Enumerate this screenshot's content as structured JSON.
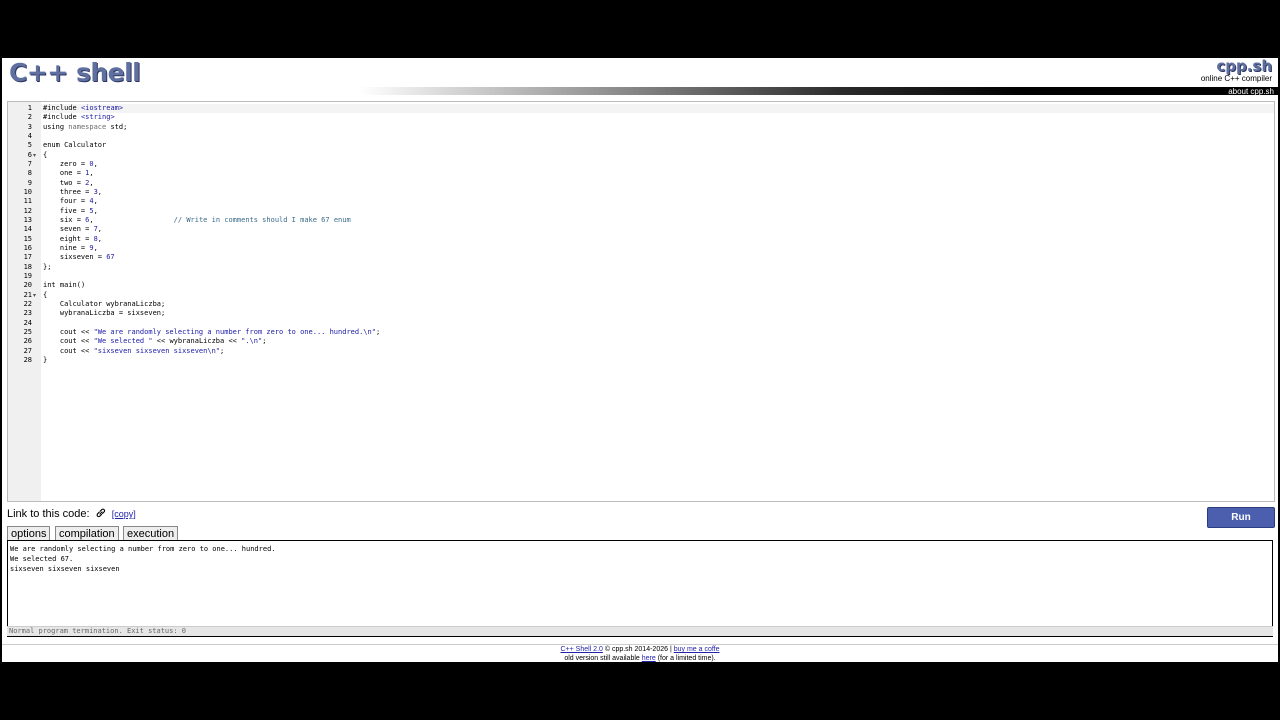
{
  "header": {
    "logo": "C++ shell",
    "brand": "cpp.sh",
    "brand_sub": "online C++ compiler",
    "about": "about cpp.sh"
  },
  "editor": {
    "lines": [
      {
        "n": "1",
        "html": "<span class='pp'>#include</span> <span class='str'>&lt;iostream&gt;</span>"
      },
      {
        "n": "2",
        "html": "<span class='pp'>#include</span> <span class='str'>&lt;string&gt;</span>"
      },
      {
        "n": "3",
        "html": "<span class='kw'>using</span> <span class='ns'>namespace</span> std;"
      },
      {
        "n": "4",
        "html": ""
      },
      {
        "n": "5",
        "html": "<span class='kw'>enum</span> Calculator"
      },
      {
        "n": "6",
        "html": "{",
        "fold": true
      },
      {
        "n": "7",
        "html": "    zero = <span class='num'>0</span>,"
      },
      {
        "n": "8",
        "html": "    one = <span class='num'>1</span>,"
      },
      {
        "n": "9",
        "html": "    two = <span class='num'>2</span>,"
      },
      {
        "n": "10",
        "html": "    three = <span class='num'>3</span>,"
      },
      {
        "n": "11",
        "html": "    four = <span class='num'>4</span>,"
      },
      {
        "n": "12",
        "html": "    five = <span class='num'>5</span>,"
      },
      {
        "n": "13",
        "html": "    six = <span class='num'>6</span>,                   <span class='cmt'>// Write in comments should I make 67 enum</span>"
      },
      {
        "n": "14",
        "html": "    seven = <span class='num'>7</span>,"
      },
      {
        "n": "15",
        "html": "    eight = <span class='num'>8</span>,"
      },
      {
        "n": "16",
        "html": "    nine = <span class='num'>9</span>,"
      },
      {
        "n": "17",
        "html": "    sixseven = <span class='num'>67</span>"
      },
      {
        "n": "18",
        "html": "};"
      },
      {
        "n": "19",
        "html": ""
      },
      {
        "n": "20",
        "html": "<span class='kw'>int</span> main()"
      },
      {
        "n": "21",
        "html": "{",
        "fold": true
      },
      {
        "n": "22",
        "html": "    Calculator wybranaLiczba;"
      },
      {
        "n": "23",
        "html": "    wybranaLiczba = sixseven;"
      },
      {
        "n": "24",
        "html": ""
      },
      {
        "n": "25",
        "html": "    cout &lt;&lt; <span class='str'>\"We are randomly selecting a number from zero to one... hundred.\\n\"</span>;"
      },
      {
        "n": "26",
        "html": "    cout &lt;&lt; <span class='str'>\"We selected \"</span> &lt;&lt; wybranaLiczba &lt;&lt; <span class='str'>\".\\n\"</span>;"
      },
      {
        "n": "27",
        "html": "    cout &lt;&lt; <span class='str'>\"sixseven sixseven sixseven\\n\"</span>;"
      },
      {
        "n": "28",
        "html": "}"
      }
    ]
  },
  "link_row": {
    "label": "Link to this code:",
    "copy": "[copy]"
  },
  "run_label": "Run",
  "tabs": [
    "options",
    "compilation",
    "execution"
  ],
  "output": {
    "lines": [
      "We are randomly selecting a number from zero to one... hundred.",
      "We selected 67.",
      "sixseven sixseven sixseven"
    ],
    "status": "Normal program termination. Exit status: 0"
  },
  "footer": {
    "version_link": "C++ Shell 2.0",
    "copyright": " © cpp.sh 2014-2026 | ",
    "coffee_link": "buy me a coffe",
    "old_prefix": "old version still available ",
    "here_link": "here",
    "old_suffix": " (for a limited time)."
  }
}
